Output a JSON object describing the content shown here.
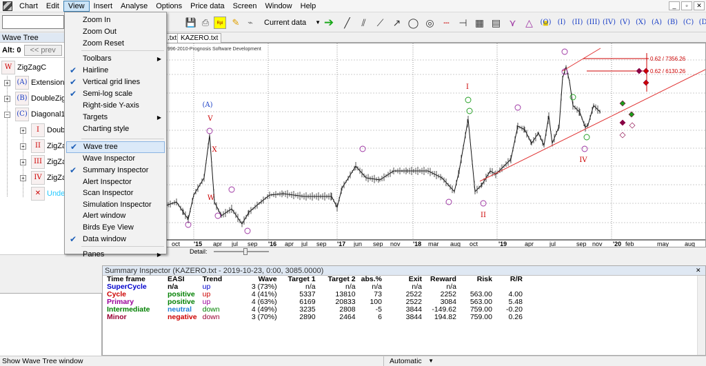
{
  "menubar": {
    "items": [
      "Chart",
      "Edit",
      "View",
      "Insert",
      "Analyse",
      "Options",
      "Price data",
      "Screen",
      "Window",
      "Help"
    ]
  },
  "toolbar": {
    "current_data_label": "Current data",
    "wave_buttons": [
      "(O)",
      "(I)",
      "(II)",
      "(III)",
      "(IV)",
      "(V)",
      "(X)",
      "(A)",
      "(B)",
      "(C)",
      "(D)"
    ]
  },
  "view_menu": {
    "items": [
      {
        "label": "Zoom In",
        "checked": false,
        "submenu": false
      },
      {
        "label": "Zoom Out",
        "checked": false,
        "submenu": false
      },
      {
        "label": "Zoom Reset",
        "checked": false,
        "submenu": false
      },
      {
        "label": "Toolbars",
        "checked": false,
        "submenu": true
      },
      {
        "label": "Hairline",
        "checked": true,
        "submenu": false
      },
      {
        "label": "Vertical grid lines",
        "checked": true,
        "submenu": false
      },
      {
        "label": "Semi-log scale",
        "checked": true,
        "submenu": false
      },
      {
        "label": "Right-side Y-axis",
        "checked": false,
        "submenu": false
      },
      {
        "label": "Targets",
        "checked": false,
        "submenu": true
      },
      {
        "label": "Charting style",
        "checked": false,
        "submenu": false
      },
      {
        "label": "Wave tree",
        "checked": true,
        "submenu": false
      },
      {
        "label": "Wave Inspector",
        "checked": false,
        "submenu": false
      },
      {
        "label": "Summary Inspector",
        "checked": true,
        "submenu": false
      },
      {
        "label": "Alert Inspector",
        "checked": false,
        "submenu": false
      },
      {
        "label": "Scan Inspector",
        "checked": false,
        "submenu": false
      },
      {
        "label": "Simulation Inspector",
        "checked": false,
        "submenu": false
      },
      {
        "label": "Alert window",
        "checked": false,
        "submenu": false
      },
      {
        "label": "Birds Eye View",
        "checked": false,
        "submenu": false
      },
      {
        "label": "Data window",
        "checked": true,
        "submenu": false
      },
      {
        "label": "Panes",
        "checked": false,
        "submenu": true
      }
    ]
  },
  "wave_tree": {
    "title": "Wave Tree",
    "alt_label": "Alt: 0",
    "prev_label": "<< prev",
    "nodes": [
      {
        "icon": "W",
        "label": "ZigZagC"
      },
      {
        "icon": "(A)",
        "label": "Extension3"
      },
      {
        "icon": "(B)",
        "label": "DoubleZigZ"
      },
      {
        "icon": "(C)",
        "label": "Diagonal10"
      },
      {
        "icon": "I",
        "label": "Doubl"
      },
      {
        "icon": "II",
        "label": "ZigZa"
      },
      {
        "icon": "III",
        "label": "ZigZa"
      },
      {
        "icon": "IV",
        "label": "ZigZa"
      },
      {
        "icon": "X",
        "label": "Unde"
      }
    ]
  },
  "chart": {
    "tabs": [
      ".txt",
      "KAZERO.txt"
    ],
    "copyright": "996-2010-Prognosis Software Development",
    "targets": [
      "0.62 / 7356.26",
      "0.62 / 6130.26"
    ],
    "detail_label": "Detail:"
  },
  "chart_data": {
    "type": "line",
    "x_ticks": [
      "oct",
      "'15",
      "apr",
      "jul",
      "sep",
      "'16",
      "apr",
      "jul",
      "sep",
      "'17",
      "jun",
      "sep",
      "nov",
      "'18",
      "mar",
      "aug",
      "oct",
      "'19",
      "apr",
      "jul",
      "sep",
      "nov",
      "'20",
      "feb",
      "may",
      "aug"
    ],
    "wave_labels": [
      "(A)",
      "V",
      "X",
      "W",
      "I",
      "II",
      "IV"
    ],
    "grid": true
  },
  "summary": {
    "title": "Summary Inspector (KAZERO.txt - 2019-10-23, 0:00, 3085.0000)",
    "columns": [
      "Time frame",
      "EASI",
      "Trend",
      "Wave",
      "Target 1",
      "Target 2",
      "abs.%",
      "Exit",
      "Reward",
      "Risk",
      "R/R"
    ],
    "rows": [
      {
        "timeframe": "SuperCycle",
        "easi": "n/a",
        "trend": "up",
        "wave": "3 (73%)",
        "t1": "n/a",
        "t2": "n/a",
        "abs": "n/a",
        "exit": "n/a",
        "reward": "n/a",
        "risk": "",
        "rr": "",
        "color": "#0000cc",
        "easi_color": "#000000"
      },
      {
        "timeframe": "Cycle",
        "easi": "positive",
        "trend": "up",
        "wave": "4 (41%)",
        "t1": "5337",
        "t2": "13810",
        "abs": "73",
        "exit": "2522",
        "reward": "2252",
        "risk": "563.00",
        "rr": "4.00",
        "color": "#cc0000",
        "easi_color": "#008000"
      },
      {
        "timeframe": "Primary",
        "easi": "positive",
        "trend": "up",
        "wave": "4 (63%)",
        "t1": "6169",
        "t2": "20833",
        "abs": "100",
        "exit": "2522",
        "reward": "3084",
        "risk": "563.00",
        "rr": "5.48",
        "color": "#990099",
        "easi_color": "#008000"
      },
      {
        "timeframe": "Intermediate",
        "easi": "neutral",
        "trend": "down",
        "wave": "4 (49%)",
        "t1": "3235",
        "t2": "2808",
        "abs": "-5",
        "exit": "3844",
        "reward": "-149.62",
        "risk": "759.00",
        "rr": "-0.20",
        "color": "#008000",
        "easi_color": "#1e7fd8"
      },
      {
        "timeframe": "Minor",
        "easi": "negative",
        "trend": "down",
        "wave": "3 (70%)",
        "t1": "2890",
        "t2": "2464",
        "abs": "6",
        "exit": "3844",
        "reward": "194.82",
        "risk": "759.00",
        "rr": "0.26",
        "color": "#990033",
        "easi_color": "#cc0000"
      }
    ]
  },
  "status": {
    "message": "Show Wave Tree window",
    "mode": "Automatic"
  }
}
